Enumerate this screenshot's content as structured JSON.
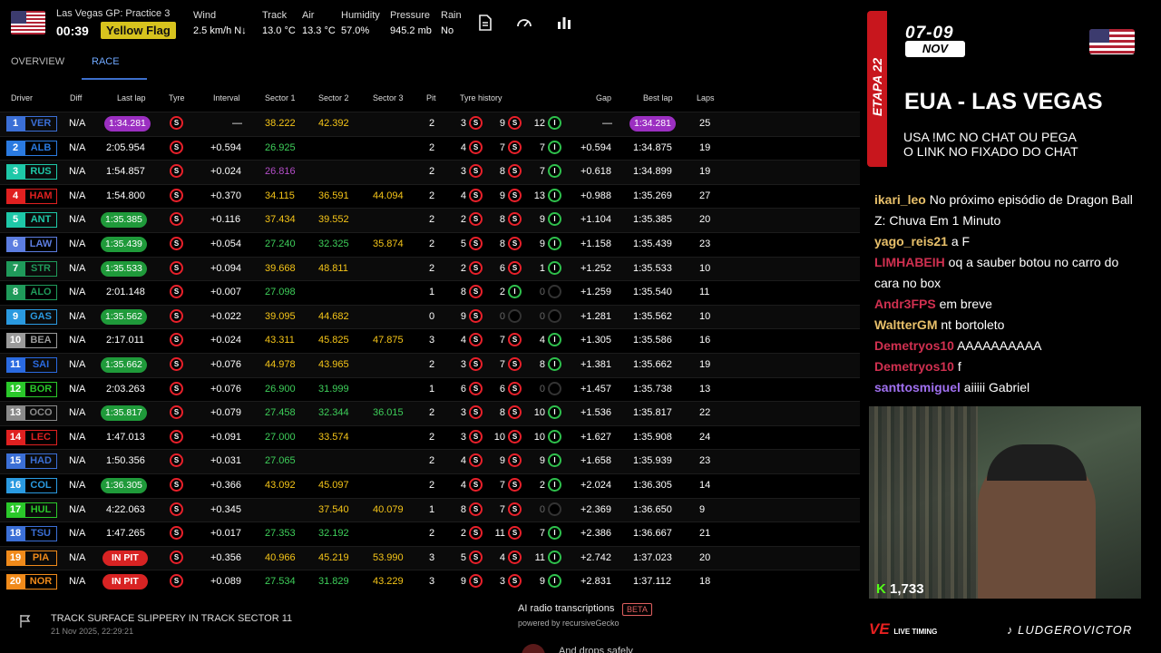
{
  "session": {
    "name": "Las Vegas GP: Practice 3",
    "time": "00:39",
    "flag": "Yellow Flag"
  },
  "weather": {
    "wind_label": "Wind",
    "wind_value": "2.5 km/h N↓",
    "track_label": "Track",
    "track_value": "13.0 °C",
    "air_label": "Air",
    "air_value": "13.3 °C",
    "humidity_label": "Humidity",
    "humidity_value": "57.0%",
    "pressure_label": "Pressure",
    "pressure_value": "945.2 mb",
    "rain_label": "Rain",
    "rain_value": "No"
  },
  "tabs": [
    "OVERVIEW",
    "RACE"
  ],
  "active_tab": "RACE",
  "columns": [
    "Driver",
    "Diff",
    "Last lap",
    "Tyre",
    "Interval",
    "Sector 1",
    "Sector 2",
    "Sector 3",
    "Pit",
    "Tyre history",
    "Gap",
    "Best lap",
    "Laps"
  ],
  "drivers": [
    {
      "pos": "1",
      "code": "VER",
      "color": "#3b6fd6",
      "diff": "N/A",
      "last": "1:34.281",
      "last_style": "purple",
      "tyre": "S",
      "tyre_kind": "soft",
      "interval": "—",
      "s1": "38.222",
      "s1c": "#f5c518",
      "s2": "42.392",
      "s2c": "#f5c518",
      "s3": "",
      "s3c": "#f5c518",
      "pit": "2",
      "hist": [
        [
          "3",
          "soft"
        ],
        [
          "9",
          "soft"
        ],
        [
          "12",
          "int"
        ]
      ],
      "gap": "—",
      "best": "1:34.281",
      "best_style": "purple",
      "laps": "25"
    },
    {
      "pos": "2",
      "code": "ALB",
      "color": "#2a7ae0",
      "diff": "N/A",
      "last": "2:05.954",
      "last_style": "",
      "tyre": "S",
      "tyre_kind": "soft",
      "interval": "+0.594",
      "s1": "26.925",
      "s1c": "#3ecf5a",
      "s2": "",
      "s2c": "#f5c518",
      "s3": "",
      "s3c": "#f5c518",
      "pit": "2",
      "hist": [
        [
          "4",
          "soft"
        ],
        [
          "7",
          "soft"
        ],
        [
          "7",
          "int"
        ]
      ],
      "gap": "+0.594",
      "best": "1:34.875",
      "best_style": "",
      "laps": "19"
    },
    {
      "pos": "3",
      "code": "RUS",
      "color": "#1ec8a8",
      "diff": "N/A",
      "last": "1:54.857",
      "last_style": "",
      "tyre": "S",
      "tyre_kind": "soft",
      "interval": "+0.024",
      "s1": "26.816",
      "s1c": "#b44ec8",
      "s2": "",
      "s2c": "#f5c518",
      "s3": "",
      "s3c": "#f5c518",
      "pit": "2",
      "hist": [
        [
          "3",
          "soft"
        ],
        [
          "8",
          "soft"
        ],
        [
          "7",
          "int"
        ]
      ],
      "gap": "+0.618",
      "best": "1:34.899",
      "best_style": "",
      "laps": "19"
    },
    {
      "pos": "4",
      "code": "HAM",
      "color": "#e02020",
      "diff": "N/A",
      "last": "1:54.800",
      "last_style": "",
      "tyre": "S",
      "tyre_kind": "soft",
      "interval": "+0.370",
      "s1": "34.115",
      "s1c": "#f5c518",
      "s2": "36.591",
      "s2c": "#f5c518",
      "s3": "44.094",
      "s3c": "#f5c518",
      "pit": "2",
      "hist": [
        [
          "4",
          "soft"
        ],
        [
          "9",
          "soft"
        ],
        [
          "13",
          "int"
        ]
      ],
      "gap": "+0.988",
      "best": "1:35.269",
      "best_style": "",
      "laps": "27"
    },
    {
      "pos": "5",
      "code": "ANT",
      "color": "#1ec8a8",
      "diff": "N/A",
      "last": "1:35.385",
      "last_style": "green",
      "tyre": "S",
      "tyre_kind": "soft",
      "interval": "+0.116",
      "s1": "37.434",
      "s1c": "#f5c518",
      "s2": "39.552",
      "s2c": "#f5c518",
      "s3": "",
      "s3c": "#f5c518",
      "pit": "2",
      "hist": [
        [
          "2",
          "soft"
        ],
        [
          "8",
          "soft"
        ],
        [
          "9",
          "int"
        ]
      ],
      "gap": "+1.104",
      "best": "1:35.385",
      "best_style": "",
      "laps": "20"
    },
    {
      "pos": "6",
      "code": "LAW",
      "color": "#5c7de0",
      "diff": "N/A",
      "last": "1:35.439",
      "last_style": "green",
      "tyre": "S",
      "tyre_kind": "soft",
      "interval": "+0.054",
      "s1": "27.240",
      "s1c": "#3ecf5a",
      "s2": "32.325",
      "s2c": "#3ecf5a",
      "s3": "35.874",
      "s3c": "#f5c518",
      "pit": "2",
      "hist": [
        [
          "5",
          "soft"
        ],
        [
          "8",
          "soft"
        ],
        [
          "9",
          "int"
        ]
      ],
      "gap": "+1.158",
      "best": "1:35.439",
      "best_style": "",
      "laps": "23"
    },
    {
      "pos": "7",
      "code": "STR",
      "color": "#1f9a5a",
      "diff": "N/A",
      "last": "1:35.533",
      "last_style": "green",
      "tyre": "S",
      "tyre_kind": "soft",
      "interval": "+0.094",
      "s1": "39.668",
      "s1c": "#f5c518",
      "s2": "48.811",
      "s2c": "#f5c518",
      "s3": "",
      "s3c": "#f5c518",
      "pit": "2",
      "hist": [
        [
          "2",
          "soft"
        ],
        [
          "6",
          "soft"
        ],
        [
          "1",
          "int"
        ]
      ],
      "gap": "+1.252",
      "best": "1:35.533",
      "best_style": "",
      "laps": "10"
    },
    {
      "pos": "8",
      "code": "ALO",
      "color": "#1f9a5a",
      "diff": "N/A",
      "last": "2:01.148",
      "last_style": "",
      "tyre": "S",
      "tyre_kind": "soft",
      "interval": "+0.007",
      "s1": "27.098",
      "s1c": "#3ecf5a",
      "s2": "",
      "s2c": "#f5c518",
      "s3": "",
      "s3c": "#f5c518",
      "pit": "1",
      "hist": [
        [
          "8",
          "soft"
        ],
        [
          "2",
          "int"
        ],
        [
          "0",
          "none"
        ]
      ],
      "gap": "+1.259",
      "best": "1:35.540",
      "best_style": "",
      "laps": "11"
    },
    {
      "pos": "9",
      "code": "GAS",
      "color": "#2a9ae0",
      "diff": "N/A",
      "last": "1:35.562",
      "last_style": "green",
      "tyre": "S",
      "tyre_kind": "soft",
      "interval": "+0.022",
      "s1": "39.095",
      "s1c": "#f5c518",
      "s2": "44.682",
      "s2c": "#f5c518",
      "s3": "",
      "s3c": "#f5c518",
      "pit": "0",
      "hist": [
        [
          "9",
          "soft"
        ],
        [
          "0",
          "none"
        ],
        [
          "0",
          "none"
        ]
      ],
      "gap": "+1.281",
      "best": "1:35.562",
      "best_style": "",
      "laps": "10"
    },
    {
      "pos": "10",
      "code": "BEA",
      "color": "#9a9a9a",
      "diff": "N/A",
      "last": "2:17.011",
      "last_style": "",
      "tyre": "S",
      "tyre_kind": "soft",
      "interval": "+0.024",
      "s1": "43.311",
      "s1c": "#f5c518",
      "s2": "45.825",
      "s2c": "#f5c518",
      "s3": "47.875",
      "s3c": "#f5c518",
      "pit": "3",
      "hist": [
        [
          "4",
          "soft"
        ],
        [
          "7",
          "soft"
        ],
        [
          "4",
          "int"
        ]
      ],
      "gap": "+1.305",
      "best": "1:35.586",
      "best_style": "",
      "laps": "16"
    },
    {
      "pos": "11",
      "code": "SAI",
      "color": "#2a6ae0",
      "diff": "N/A",
      "last": "1:35.662",
      "last_style": "green",
      "tyre": "S",
      "tyre_kind": "soft",
      "interval": "+0.076",
      "s1": "44.978",
      "s1c": "#f5c518",
      "s2": "43.965",
      "s2c": "#f5c518",
      "s3": "",
      "s3c": "#f5c518",
      "pit": "2",
      "hist": [
        [
          "3",
          "soft"
        ],
        [
          "7",
          "soft"
        ],
        [
          "8",
          "int"
        ]
      ],
      "gap": "+1.381",
      "best": "1:35.662",
      "best_style": "",
      "laps": "19"
    },
    {
      "pos": "12",
      "code": "BOR",
      "color": "#2ac82a",
      "diff": "N/A",
      "last": "2:03.263",
      "last_style": "",
      "tyre": "S",
      "tyre_kind": "soft",
      "interval": "+0.076",
      "s1": "26.900",
      "s1c": "#3ecf5a",
      "s2": "31.999",
      "s2c": "#3ecf5a",
      "s3": "",
      "s3c": "#f5c518",
      "pit": "1",
      "hist": [
        [
          "6",
          "soft"
        ],
        [
          "6",
          "soft"
        ],
        [
          "0",
          "none"
        ]
      ],
      "gap": "+1.457",
      "best": "1:35.738",
      "best_style": "",
      "laps": "13"
    },
    {
      "pos": "13",
      "code": "OCO",
      "color": "#8a8a8a",
      "diff": "N/A",
      "last": "1:35.817",
      "last_style": "green",
      "tyre": "S",
      "tyre_kind": "soft",
      "interval": "+0.079",
      "s1": "27.458",
      "s1c": "#3ecf5a",
      "s2": "32.344",
      "s2c": "#3ecf5a",
      "s3": "36.015",
      "s3c": "#3ecf5a",
      "pit": "2",
      "hist": [
        [
          "3",
          "soft"
        ],
        [
          "8",
          "soft"
        ],
        [
          "10",
          "int"
        ]
      ],
      "gap": "+1.536",
      "best": "1:35.817",
      "best_style": "",
      "laps": "22"
    },
    {
      "pos": "14",
      "code": "LEC",
      "color": "#e02020",
      "diff": "N/A",
      "last": "1:47.013",
      "last_style": "",
      "tyre": "S",
      "tyre_kind": "soft",
      "interval": "+0.091",
      "s1": "27.000",
      "s1c": "#3ecf5a",
      "s2": "33.574",
      "s2c": "#f5c518",
      "s3": "",
      "s3c": "#f5c518",
      "pit": "2",
      "hist": [
        [
          "3",
          "soft"
        ],
        [
          "10",
          "soft"
        ],
        [
          "10",
          "int"
        ]
      ],
      "gap": "+1.627",
      "best": "1:35.908",
      "best_style": "",
      "laps": "24"
    },
    {
      "pos": "15",
      "code": "HAD",
      "color": "#3b6fd6",
      "diff": "N/A",
      "last": "1:50.356",
      "last_style": "",
      "tyre": "S",
      "tyre_kind": "soft",
      "interval": "+0.031",
      "s1": "27.065",
      "s1c": "#3ecf5a",
      "s2": "",
      "s2c": "#f5c518",
      "s3": "",
      "s3c": "#f5c518",
      "pit": "2",
      "hist": [
        [
          "4",
          "soft"
        ],
        [
          "9",
          "soft"
        ],
        [
          "9",
          "int"
        ]
      ],
      "gap": "+1.658",
      "best": "1:35.939",
      "best_style": "",
      "laps": "23"
    },
    {
      "pos": "16",
      "code": "COL",
      "color": "#2a9ae0",
      "diff": "N/A",
      "last": "1:36.305",
      "last_style": "green",
      "tyre": "S",
      "tyre_kind": "soft",
      "interval": "+0.366",
      "s1": "43.092",
      "s1c": "#f5c518",
      "s2": "45.097",
      "s2c": "#f5c518",
      "s3": "",
      "s3c": "#f5c518",
      "pit": "2",
      "hist": [
        [
          "4",
          "soft"
        ],
        [
          "7",
          "soft"
        ],
        [
          "2",
          "int"
        ]
      ],
      "gap": "+2.024",
      "best": "1:36.305",
      "best_style": "",
      "laps": "14"
    },
    {
      "pos": "17",
      "code": "HUL",
      "color": "#2ac82a",
      "diff": "N/A",
      "last": "4:22.063",
      "last_style": "",
      "tyre": "S",
      "tyre_kind": "soft",
      "interval": "+0.345",
      "s1": "",
      "s1c": "#f5c518",
      "s2": "37.540",
      "s2c": "#f5c518",
      "s3": "40.079",
      "s3c": "#f5c518",
      "pit": "1",
      "hist": [
        [
          "8",
          "soft"
        ],
        [
          "7",
          "soft"
        ],
        [
          "0",
          "none"
        ]
      ],
      "gap": "+2.369",
      "best": "1:36.650",
      "best_style": "",
      "laps": "9"
    },
    {
      "pos": "18",
      "code": "TSU",
      "color": "#3b6fd6",
      "diff": "N/A",
      "last": "1:47.265",
      "last_style": "",
      "tyre": "S",
      "tyre_kind": "soft",
      "interval": "+0.017",
      "s1": "27.353",
      "s1c": "#3ecf5a",
      "s2": "32.192",
      "s2c": "#3ecf5a",
      "s3": "",
      "s3c": "#f5c518",
      "pit": "2",
      "hist": [
        [
          "2",
          "soft"
        ],
        [
          "11",
          "soft"
        ],
        [
          "7",
          "int"
        ]
      ],
      "gap": "+2.386",
      "best": "1:36.667",
      "best_style": "",
      "laps": "21"
    },
    {
      "pos": "19",
      "code": "PIA",
      "color": "#f08a1a",
      "diff": "N/A",
      "last": "IN PIT",
      "last_style": "pit",
      "tyre": "S",
      "tyre_kind": "soft",
      "interval": "+0.356",
      "s1": "40.966",
      "s1c": "#f5c518",
      "s2": "45.219",
      "s2c": "#f5c518",
      "s3": "53.990",
      "s3c": "#f5c518",
      "pit": "3",
      "hist": [
        [
          "5",
          "soft"
        ],
        [
          "4",
          "soft"
        ],
        [
          "11",
          "int"
        ]
      ],
      "gap": "+2.742",
      "best": "1:37.023",
      "best_style": "",
      "laps": "20"
    },
    {
      "pos": "20",
      "code": "NOR",
      "color": "#f08a1a",
      "diff": "N/A",
      "last": "IN PIT",
      "last_style": "pit",
      "tyre": "S",
      "tyre_kind": "soft",
      "interval": "+0.089",
      "s1": "27.534",
      "s1c": "#3ecf5a",
      "s2": "31.829",
      "s2c": "#3ecf5a",
      "s3": "43.229",
      "s3c": "#f5c518",
      "pit": "3",
      "hist": [
        [
          "9",
          "soft"
        ],
        [
          "3",
          "soft"
        ],
        [
          "9",
          "int"
        ]
      ],
      "gap": "+2.831",
      "best": "1:37.112",
      "best_style": "",
      "laps": "18"
    }
  ],
  "footer": {
    "message": "TRACK SURFACE SLIPPERY IN TRACK SECTOR 11",
    "timestamp": "21 Nov 2025, 22:29:21",
    "radio_title": "AI radio transcriptions",
    "beta": "BETA",
    "powered": "powered by recursiveGecko",
    "radio_line": "And drops safely"
  },
  "overlay": {
    "etapa": "ETAPA 22",
    "dates": "07-09",
    "month": "NOV",
    "title": "EUA - LAS VEGAS",
    "sub1": "USA !MC NO CHAT OU PEGA",
    "sub2": "O LINK NO FIXADO DO CHAT",
    "viewers": "1,733",
    "brand": "LIVE TIMING",
    "tiktok": "LUDGEROVICTOR"
  },
  "chat": [
    {
      "user": "ikari_leo",
      "color": "#e8c06a",
      "msg": "No próximo episódio de Dragon Ball Z: Chuva Em 1 Minuto"
    },
    {
      "user": "yago_reis21",
      "color": "#e8c06a",
      "msg": "a F"
    },
    {
      "user": "LIMHABEIH",
      "color": "#d03050",
      "msg": "oq a sauber botou no carro do cara no box"
    },
    {
      "user": "Andr3FPS",
      "color": "#d03050",
      "msg": "em breve"
    },
    {
      "user": "WaltterGM",
      "color": "#e8c06a",
      "msg": "nt bortoleto"
    },
    {
      "user": "Demetryos10",
      "color": "#d03050",
      "msg": "AAAAAAAAAA"
    },
    {
      "user": "Demetryos10",
      "color": "#d03050",
      "msg": "f"
    },
    {
      "user": "santtosmiguel",
      "color": "#a070f0",
      "msg": "aiiiii Gabriel"
    }
  ]
}
